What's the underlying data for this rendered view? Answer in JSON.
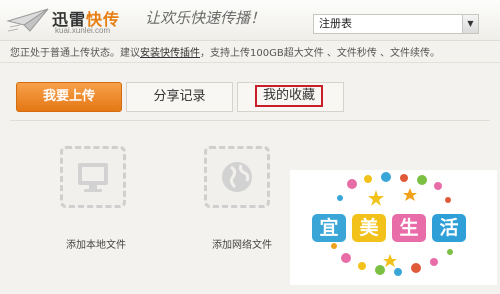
{
  "header": {
    "logo_title_main": "迅雷",
    "logo_title_accent": "快传",
    "logo_url": "kuai.xunlei.com",
    "slogan": "让欢乐快速传播！",
    "register_value": "注册表",
    "register_arrow": "▼"
  },
  "notice": {
    "prefix": "您正处于普通上传状态。建议",
    "link": "安装快传插件",
    "suffix": "，支持上传100GB超大文件 、文件秒传 、文件续传。"
  },
  "tabs": [
    {
      "label": "我要上传",
      "active": true
    },
    {
      "label": "分享记录",
      "active": false
    },
    {
      "label": "我的收藏",
      "active": false,
      "highlighted": true
    }
  ],
  "upload_options": [
    {
      "label": "添加本地文件",
      "icon": "monitor-icon"
    },
    {
      "label": "添加网络文件",
      "icon": "globe-icon"
    }
  ],
  "promo": {
    "chars": [
      "宜",
      "美",
      "生",
      "活"
    ],
    "colors": {
      "box1": "#3aa6d8",
      "box2": "#f2c21a",
      "box3": "#e86ca8",
      "box4": "#2f9fd8"
    }
  },
  "colors": {
    "accent": "#e77e12",
    "highlight": "#c8202a"
  }
}
